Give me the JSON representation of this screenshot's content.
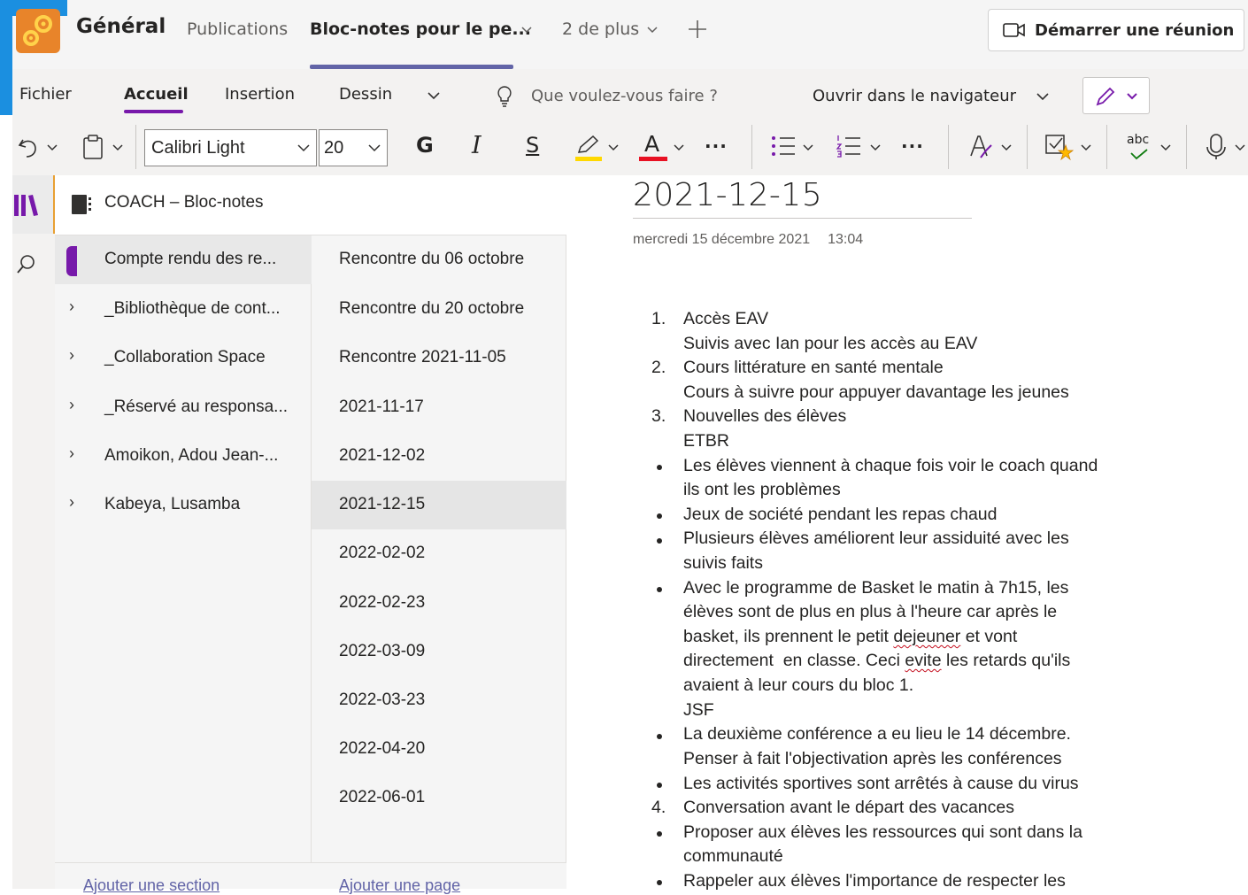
{
  "teams": {
    "channel_name": "Général",
    "tabs": [
      "Publications",
      "Bloc-notes pour le pe...",
      "2 de plus"
    ],
    "meeting_button": "Démarrer une réunion"
  },
  "ribbon": {
    "tabs": [
      "Fichier",
      "Accueil",
      "Insertion",
      "Dessin"
    ],
    "tell_me": "Que voulez-vous faire ?",
    "open_in_browser": "Ouvrir dans le navigateur",
    "font_name": "Calibri Light",
    "font_size": "20",
    "bold": "G",
    "italic": "I",
    "underline": "S",
    "font_color_letter": "A",
    "more": "···",
    "spell_label": "abc",
    "highlight_color": "#ffd800",
    "font_color": "#e81123"
  },
  "notebook": {
    "title": "COACH – Bloc-notes",
    "sections": [
      "Compte rendu des re...",
      "_Bibliothèque de cont...",
      "_Collaboration Space",
      "_Réservé au responsa...",
      "Amoikon, Adou Jean-...",
      "Kabeya, Lusamba"
    ],
    "pages": [
      "Rencontre du 06 octobre",
      "Rencontre du 20 octobre",
      "Rencontre 2021-11-05",
      "2021-11-17",
      "2021-12-02",
      "2021-12-15",
      "2022-02-02",
      "2022-02-23",
      "2022-03-09",
      "2022-03-23",
      "2022-04-20",
      "2022-06-01"
    ],
    "add_section": "Ajouter une section",
    "add_page": "Ajouter une page"
  },
  "page": {
    "title": "2021-12-15",
    "date": "mercredi 15 décembre 2021",
    "time": "13:04",
    "content": {
      "n1": "1.",
      "l1": "Accès EAV",
      "l1b": "Suivis avec Ian pour les accès au EAV",
      "n2": "2.",
      "l2": "Cours littérature en santé mentale",
      "l2b": "Cours à suivre pour appuyer davantage les jeunes",
      "n3": "3.",
      "l3": "Nouvelles des élèves",
      "l3b": "ETBR",
      "b1a": "Les élèves viennent à chaque fois voir le coach quand",
      "b1b": "ils ont les problèmes",
      "b2": "Jeux de société pendant les repas chaud",
      "b3a": "Plusieurs élèves améliorent leur assiduité avec les",
      "b3b": "suivis faits",
      "b4a": "Avec le programme de Basket le matin à 7h15, les",
      "b4b": "élèves sont de plus en plus à l'heure car après le",
      "b4c_pre": "basket, ils prennent le petit ",
      "b4c_err": "dejeuner",
      "b4c_post": " et vont",
      "b4d": "directement  en classe. Ceci ",
      "b4d_err": "evite",
      "b4d_post": " les retards qu'ils",
      "b4e": "avaient à leur cours du bloc 1.",
      "b4f": "JSF",
      "b5a": "La deuxième conférence a eu lieu le 14 décembre.",
      "b5b": "Penser à fait l'objectivation après les conférences",
      "b6": "Les activités sportives sont arrêtés à cause du virus",
      "n4": "4.",
      "l4": "Conversation avant le départ des vacances",
      "b7a": "Proposer aux élèves les ressources qui sont dans la",
      "b7b": "communauté",
      "b8": "Rappeler aux élèves l'importance de respecter les"
    }
  }
}
